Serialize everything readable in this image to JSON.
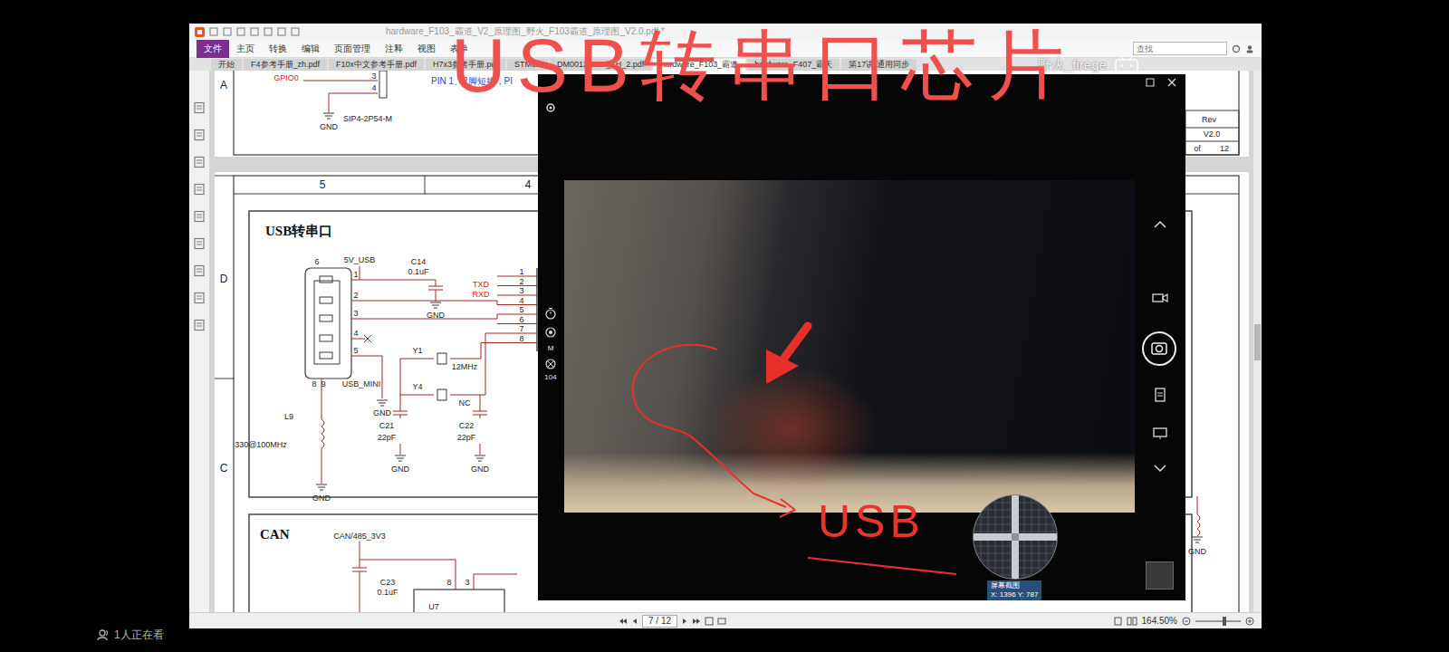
{
  "overlay_title": "USB转串口芯片",
  "viewer": {
    "title": "hardware_F103_霸道_V2_原理图_野火_F103霸道_原理图_V2.0.pdf *",
    "menu": [
      {
        "label": "文件",
        "selected": true
      },
      {
        "label": "主页",
        "selected": false
      },
      {
        "label": "转换",
        "selected": false
      },
      {
        "label": "编辑",
        "selected": false
      },
      {
        "label": "页面管理",
        "selected": false
      },
      {
        "label": "注释",
        "selected": false
      },
      {
        "label": "视图",
        "selected": false
      },
      {
        "label": "表单",
        "selected": false
      }
    ],
    "search": {
      "placeholder": "查找"
    },
    "tabs": [
      {
        "label": "开始",
        "selected": false
      },
      {
        "label": "F4参考手册_zh.pdf",
        "selected": false
      },
      {
        "label": "F10x中文参考手册.pdf",
        "selected": false
      },
      {
        "label": "H7x3参考手册.pdf",
        "selected": false
      },
      {
        "label": "STM32",
        "selected": false
      },
      {
        "label": "DM00124865_ZH_2.pdf",
        "selected": false
      },
      {
        "label": "hardware_F103_霸道",
        "selected": true
      },
      {
        "label": "hardware_F407_霸天",
        "selected": false
      },
      {
        "label": "第17讲-通用同步",
        "selected": false
      }
    ],
    "page": "7 / 12",
    "zoom": "164.50%"
  },
  "watermark": "野火_firege",
  "schematic": {
    "row_labels": [
      "A",
      "D",
      "C"
    ],
    "col_labels": [
      "5",
      "4"
    ],
    "sections": [
      "USB转串口",
      "CAN"
    ],
    "labels": [
      {
        "text": "GPIO0",
        "kind": "net"
      },
      {
        "text": "3",
        "kind": "pin"
      },
      {
        "text": "4",
        "kind": "pin"
      },
      {
        "text": "SIP4-2P54-M",
        "kind": "part"
      },
      {
        "text": "GND",
        "kind": "part"
      },
      {
        "text": "PIN 1、2脚短接，PI",
        "kind": "note"
      },
      {
        "text": "5V_USB",
        "kind": "part"
      },
      {
        "text": "C14",
        "kind": "part"
      },
      {
        "text": "0.1uF",
        "kind": "part"
      },
      {
        "text": "GND",
        "kind": "part"
      },
      {
        "text": "TXD",
        "kind": "net"
      },
      {
        "text": "RXD",
        "kind": "net"
      },
      {
        "text": "1",
        "kind": "pin"
      },
      {
        "text": "2",
        "kind": "pin"
      },
      {
        "text": "3",
        "kind": "pin"
      },
      {
        "text": "4",
        "kind": "pin"
      },
      {
        "text": "5",
        "kind": "pin"
      },
      {
        "text": "6",
        "kind": "pin"
      },
      {
        "text": "8",
        "kind": "pin"
      },
      {
        "text": "9",
        "kind": "pin"
      },
      {
        "text": "1",
        "kind": "pin"
      },
      {
        "text": "2",
        "kind": "pin"
      },
      {
        "text": "3",
        "kind": "pin"
      },
      {
        "text": "4",
        "kind": "pin"
      },
      {
        "text": "5",
        "kind": "pin"
      },
      {
        "text": "6",
        "kind": "pin"
      },
      {
        "text": "7",
        "kind": "pin"
      },
      {
        "text": "8",
        "kind": "pin"
      },
      {
        "text": "USB_MINI",
        "kind": "part"
      },
      {
        "text": "GND",
        "kind": "part"
      },
      {
        "text": "Y1",
        "kind": "part"
      },
      {
        "text": "12MHz",
        "kind": "part"
      },
      {
        "text": "Y4",
        "kind": "part"
      },
      {
        "text": "NC",
        "kind": "part"
      },
      {
        "text": "C21",
        "kind": "part"
      },
      {
        "text": "22pF",
        "kind": "part"
      },
      {
        "text": "C22",
        "kind": "part"
      },
      {
        "text": "22pF",
        "kind": "part"
      },
      {
        "text": "GND",
        "kind": "part"
      },
      {
        "text": "GND",
        "kind": "part"
      },
      {
        "text": "L9",
        "kind": "part"
      },
      {
        "text": "330@100MHz",
        "kind": "part"
      },
      {
        "text": "GND",
        "kind": "part"
      },
      {
        "text": "CAN/485_3V3",
        "kind": "part"
      },
      {
        "text": "C23",
        "kind": "part"
      },
      {
        "text": "0.1uF",
        "kind": "part"
      },
      {
        "text": "U7",
        "kind": "part"
      },
      {
        "text": "8",
        "kind": "pin"
      },
      {
        "text": "3",
        "kind": "pin"
      },
      {
        "text": "Rev",
        "kind": "part"
      },
      {
        "text": "V2.0",
        "kind": "part"
      },
      {
        "text": "of",
        "kind": "part"
      },
      {
        "text": "12",
        "kind": "part"
      },
      {
        "text": "GND",
        "kind": "part"
      }
    ]
  },
  "camera": {
    "mode": "M",
    "count": "104"
  },
  "annotation": "USB",
  "tooltip": {
    "title": "屏幕截图",
    "coords": "X: 1396 Y: 787"
  },
  "audience": "1人正在看"
}
